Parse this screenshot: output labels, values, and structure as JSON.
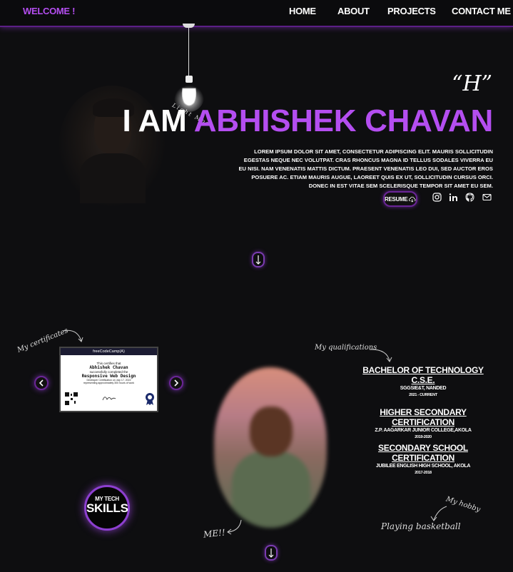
{
  "header": {
    "welcome": "WELCOME !",
    "nav": [
      "HOME",
      "ABOUT",
      "PROJECTS",
      "CONTACT ME"
    ]
  },
  "lamp": {
    "label": "Light Mode"
  },
  "hero": {
    "quote": "“H”",
    "title_prefix": "I AM",
    "title_name": "ABHISHEK CHAVAN",
    "text": "Lorem ipsum dolor sit amet, consectetur adipiscing elit. Mauris sollicitudin egestas neque nec volutpat. Cras rhoncus magna id tellus sodales viverra eu eu nisi. Nam venenatis mattis dictum. Praesent venenatis leo dui, sed auctor eros posuere ac. Etiam mauris augue, laoreet quis ex ut, sollicitudin cursus orci. Donec in est vitae sem scelerisque tempor sit amet eu sem.",
    "resume_label": "RESUME",
    "socials": [
      "instagram-icon",
      "linkedin-icon",
      "github-icon",
      "mail-icon"
    ]
  },
  "certificates": {
    "label": "My certificates",
    "card": {
      "header": "freeCodeCamp(A)",
      "line1": "This certifies that",
      "name": "Abhishek Chavan",
      "line2": "successfully completed the",
      "course": "Responsive Web Design",
      "line3": "Developer Certification on July 17, 2022",
      "line4": "representing approximately 300 hours of work"
    }
  },
  "qualifications": {
    "label": "My qualifications",
    "items": [
      {
        "title": "BACHELOR OF TECHNOLOGY C.S.E.",
        "school": "SGGSIE&T, NANDED",
        "years": "2021 - CURRENT"
      },
      {
        "title": "HIGHER SECONDARY CERTIFICATION",
        "school": "Z.P. AAGARKAR JUNIOR COLLEGE,AKOLA",
        "years": "2019-2020"
      },
      {
        "title": "SECONDARY SCHOOL CERTIFICATION",
        "school": "JUBILEE ENGLISH HIGH SCHOOL, AKOLA",
        "years": "2017-2018"
      }
    ]
  },
  "me_label": "ME!!",
  "skills": {
    "line1": "MY TECH",
    "line2": "SKILLS"
  },
  "hobby": {
    "label": "My hobby",
    "value": "Playing basketball"
  },
  "colors": {
    "accent": "#b44ef0",
    "border_glow": "#6a2596",
    "background": "#0e0e10"
  }
}
